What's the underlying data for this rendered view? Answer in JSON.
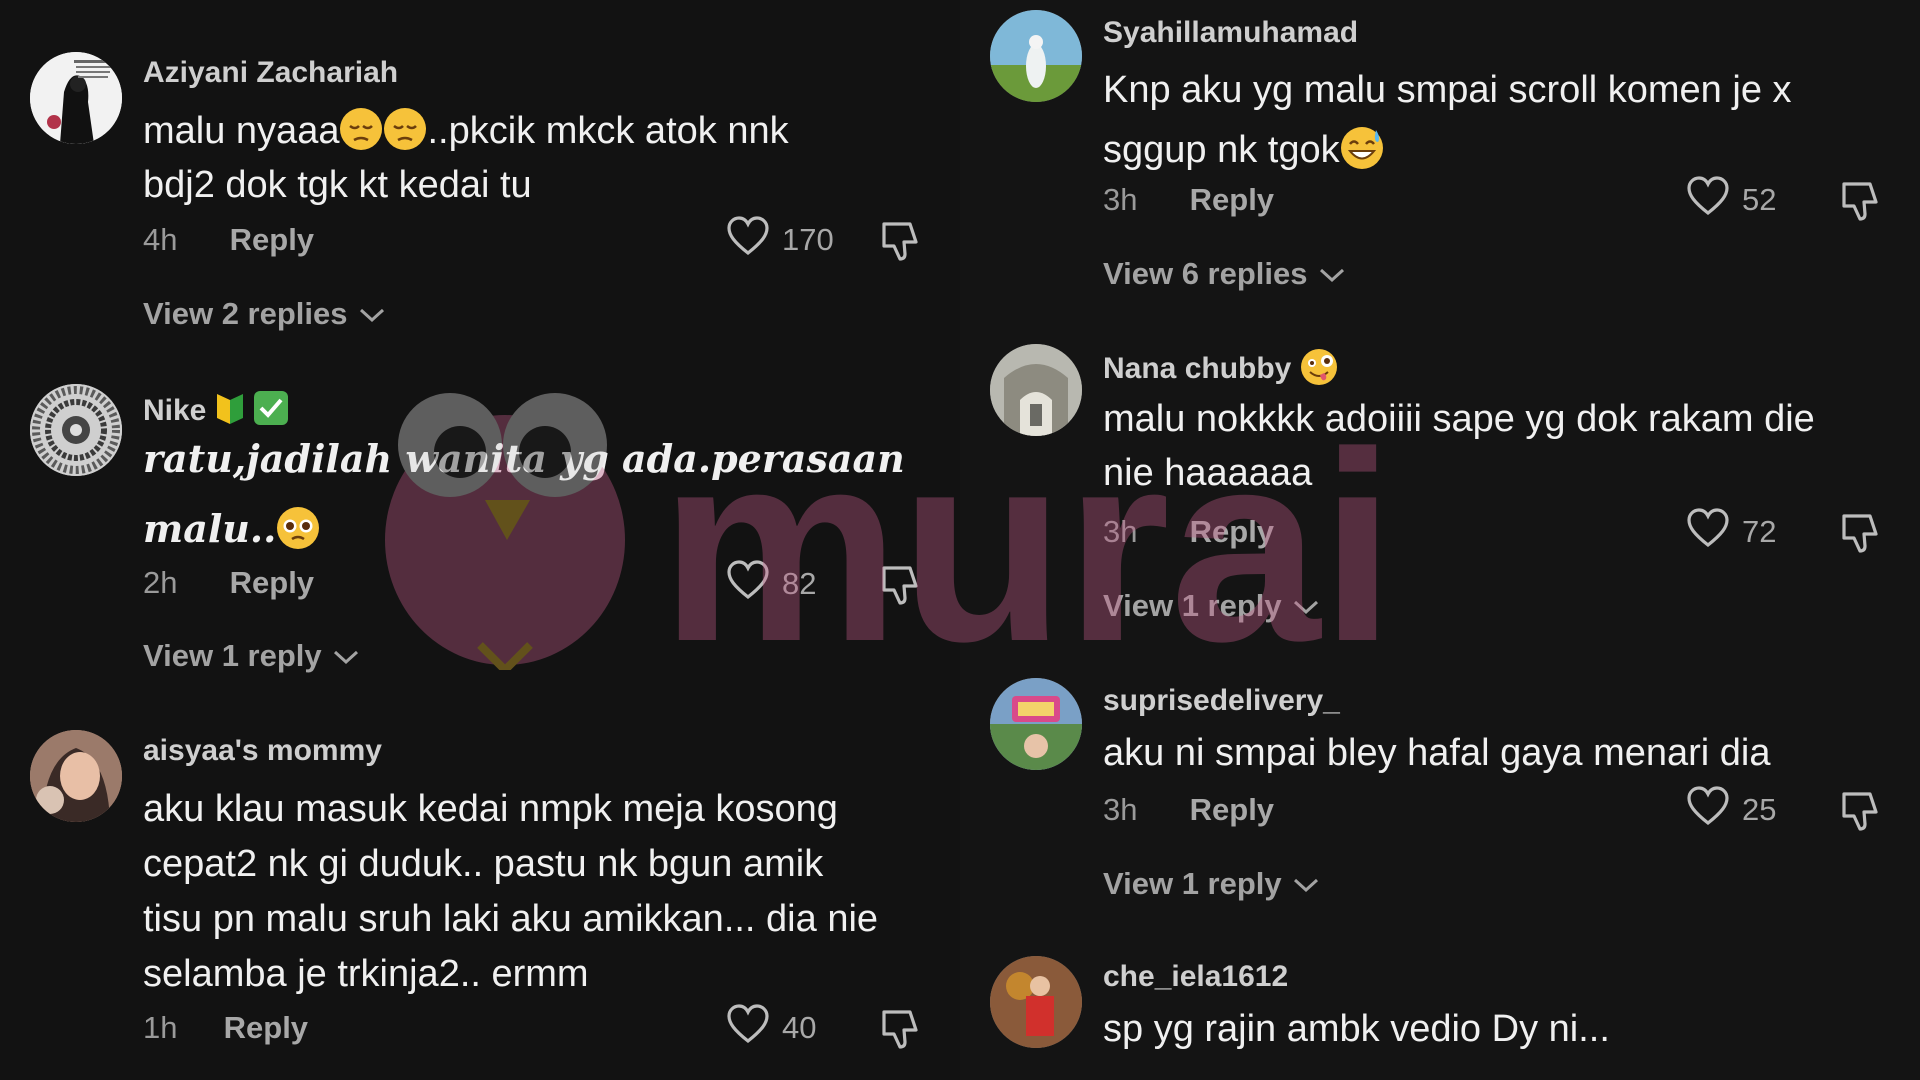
{
  "left": {
    "comments": [
      {
        "user": "Aziyani Zachariah",
        "text1": "malu nyaaa",
        "text2": "..pkcik mkck atok nnk",
        "text3": "bdj2 dok tgk kt kedai tu",
        "time": "4h",
        "reply": "Reply",
        "likes": "170",
        "view_replies": "View 2 replies"
      },
      {
        "user": "Nike",
        "text1": "ratu,jadilah wanita yg ada.perasaan",
        "text2": "malu..",
        "time": "2h",
        "reply": "Reply",
        "likes": "82",
        "view_replies": "View 1 reply"
      },
      {
        "user": "aisyaa's mommy",
        "line1": "aku klau masuk kedai nmpk meja kosong",
        "line2": "cepat2 nk gi duduk.. pastu nk bgun amik",
        "line3": "tisu pn malu sruh laki aku amikkan... dia nie",
        "line4": "selamba je trkinja2.. ermm",
        "time": "1h",
        "reply": "Reply",
        "likes": "40"
      }
    ]
  },
  "right": {
    "comments": [
      {
        "user": "Syahillamuhamad",
        "line1": "Knp aku yg malu smpai scroll komen je x",
        "line2": "sggup nk tgok",
        "time": "3h",
        "reply": "Reply",
        "likes": "52",
        "view_replies": "View 6 replies"
      },
      {
        "user": "Nana chubby",
        "line1": "malu nokkkk adoiiii sape yg dok rakam die",
        "line2": "nie haaaaaa",
        "time": "3h",
        "reply": "Reply",
        "likes": "72",
        "view_replies": "View 1 reply"
      },
      {
        "user": "suprisedelivery_",
        "line1": "aku ni smpai bley hafal gaya menari dia",
        "time": "3h",
        "reply": "Reply",
        "likes": "25",
        "view_replies": "View 1 reply"
      },
      {
        "user": "che_iela1612",
        "line1": "sp yg rajin ambk vedio Dy ni..."
      }
    ]
  },
  "watermark": {
    "text": "murai",
    "color": "#c05a86"
  },
  "colors": {
    "background": "#121212",
    "text": "#f0f0f0",
    "muted": "#9a9a9a"
  }
}
